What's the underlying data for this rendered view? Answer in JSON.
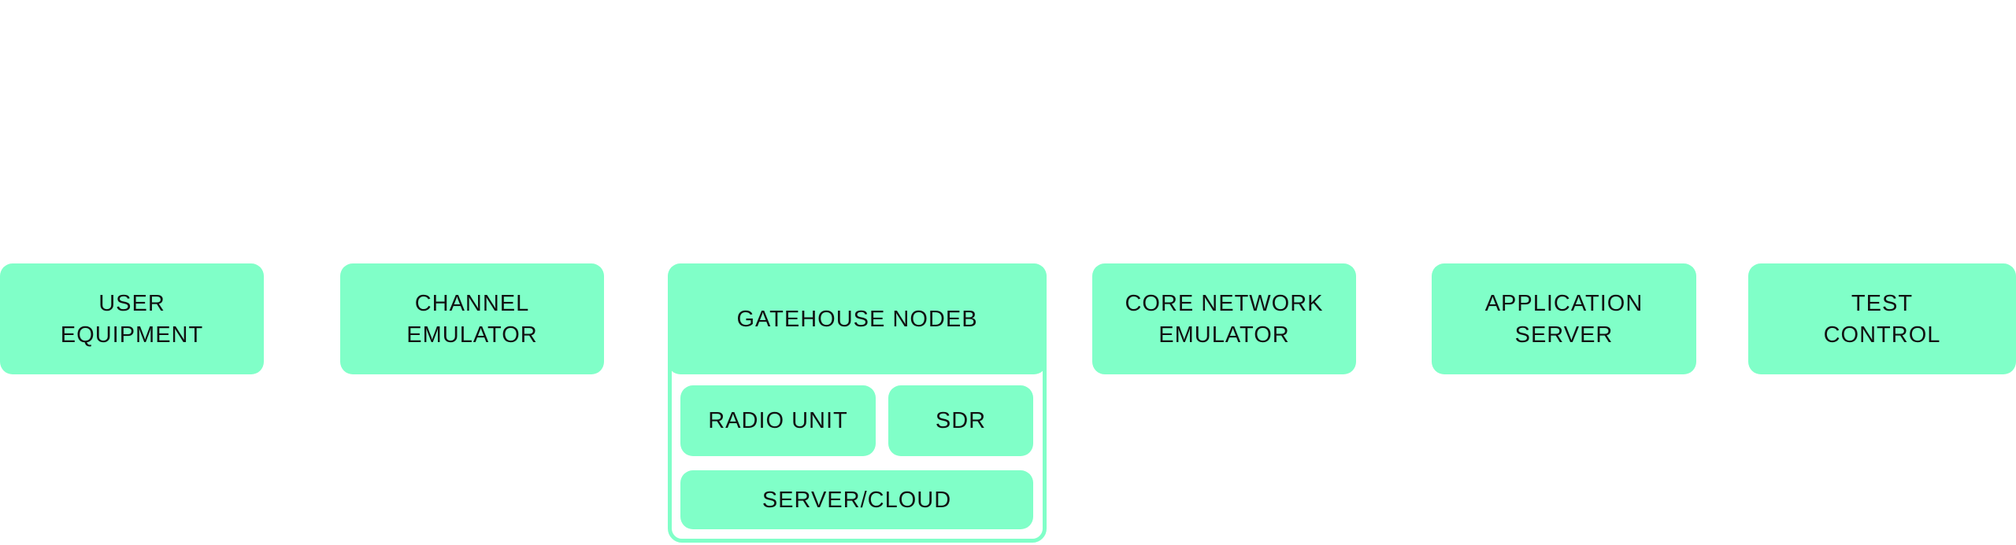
{
  "accent_color": "#80ffc8",
  "blocks": [
    {
      "label": "USER\nEQUIPMENT"
    },
    {
      "label": "CHANNEL\nEMULATOR"
    },
    {
      "label": "GATEHOUSE NODEB"
    },
    {
      "label": "CORE NETWORK\nEMULATOR"
    },
    {
      "label": "APPLICATION\nSERVER"
    },
    {
      "label": "TEST\nCONTROL"
    }
  ],
  "gatehouse_components": [
    {
      "label": "RADIO UNIT"
    },
    {
      "label": "SDR"
    },
    {
      "label": "SERVER/CLOUD"
    }
  ]
}
